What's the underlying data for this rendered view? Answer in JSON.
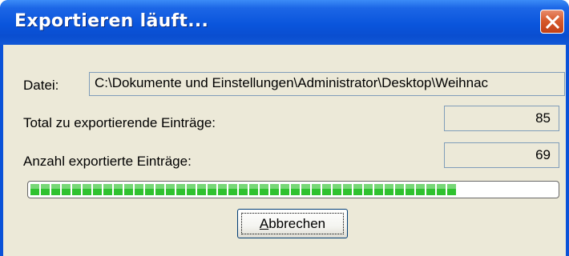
{
  "window": {
    "title": "Exportieren läuft..."
  },
  "title_bar": {
    "close_icon": "close-icon"
  },
  "file": {
    "label": "Datei:",
    "value": "C:\\Dokumente und Einstellungen\\Administrator\\Desktop\\Weihnac"
  },
  "total": {
    "label": "Total zu exportierende Einträge:",
    "value": "85"
  },
  "exported": {
    "label": "Anzahl exportierte Einträge:",
    "value": "69"
  },
  "progress": {
    "fraction": 0.812,
    "color": "#2fc22f"
  },
  "cancel_button": {
    "mnemonic": "A",
    "rest": "bbrechen"
  },
  "colors": {
    "titlebar": "#0a55dc",
    "client": "#ece9d8",
    "field_border": "#7f9db9",
    "close_button": "#d75a2c"
  }
}
